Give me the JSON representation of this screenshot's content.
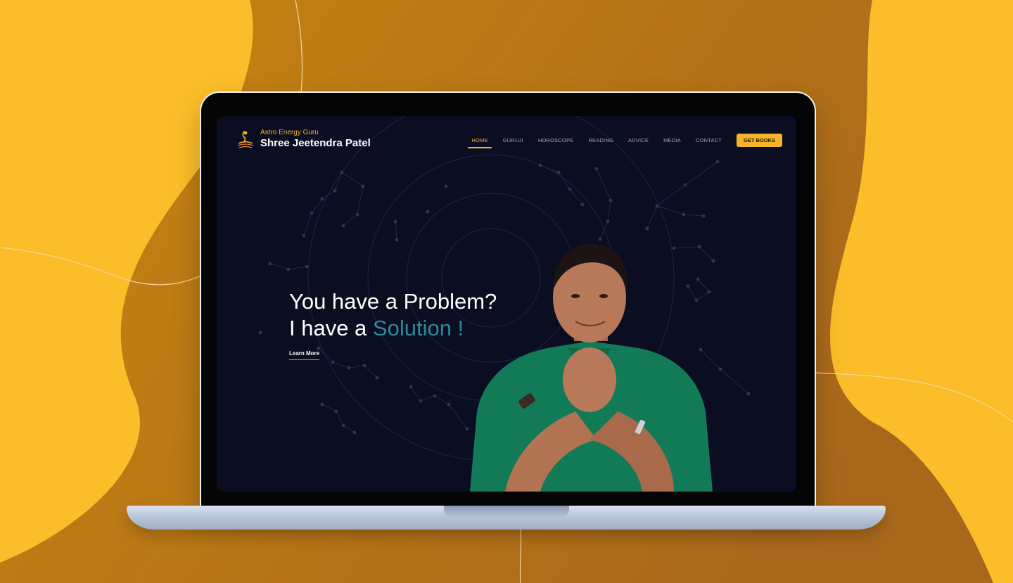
{
  "brand": {
    "tagline": "Astro Energy Guru",
    "name": "Shree Jeetendra Patel"
  },
  "nav": {
    "items": [
      "HOME",
      "GURUJI",
      "HOROSCOPE",
      "READING",
      "ADVICE",
      "MEDIA",
      "CONTACT"
    ],
    "active": "HOME",
    "cta_label": "GET BOOKS"
  },
  "hero": {
    "line1": "You have a Problem?",
    "line2_prefix": "I have a ",
    "line2_highlight": "Solution !",
    "link_label": "Learn More"
  },
  "colors": {
    "page_background": "#c7820f",
    "blob": "#fbbd2a",
    "screen_background": "#0b0d21",
    "accent_yellow": "#f6b42a",
    "accent_teal": "#2b8b9a",
    "shirt_green": "#137a57"
  },
  "icons": {
    "logo": "cobra-lamp-logo",
    "background": "zodiac-wheel"
  }
}
